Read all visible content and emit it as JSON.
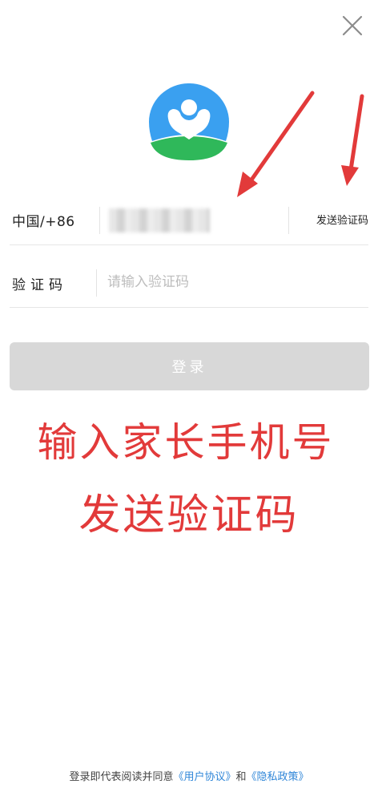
{
  "header": {
    "close_icon": "close-icon"
  },
  "logo": {
    "icon": "app-logo",
    "colors": {
      "blue": "#3aa0f0",
      "green": "#2fb85a",
      "white": "#ffffff"
    }
  },
  "form": {
    "phone": {
      "country_code": "中国/+86",
      "value": ""
    },
    "send_code_label": "发送验证码",
    "code": {
      "label": "验证码",
      "placeholder": "请输入验证码",
      "value": ""
    },
    "login_label": "登录"
  },
  "annotations": {
    "line1": "输入家长手机号",
    "line2": "发送验证码",
    "color": "#e23a3a"
  },
  "footer": {
    "prefix": "登录即代表阅读并同意",
    "user_agreement": "《用户协议》",
    "conjunction": "和",
    "privacy_policy": "《隐私政策》",
    "link_color": "#2f86d8"
  }
}
